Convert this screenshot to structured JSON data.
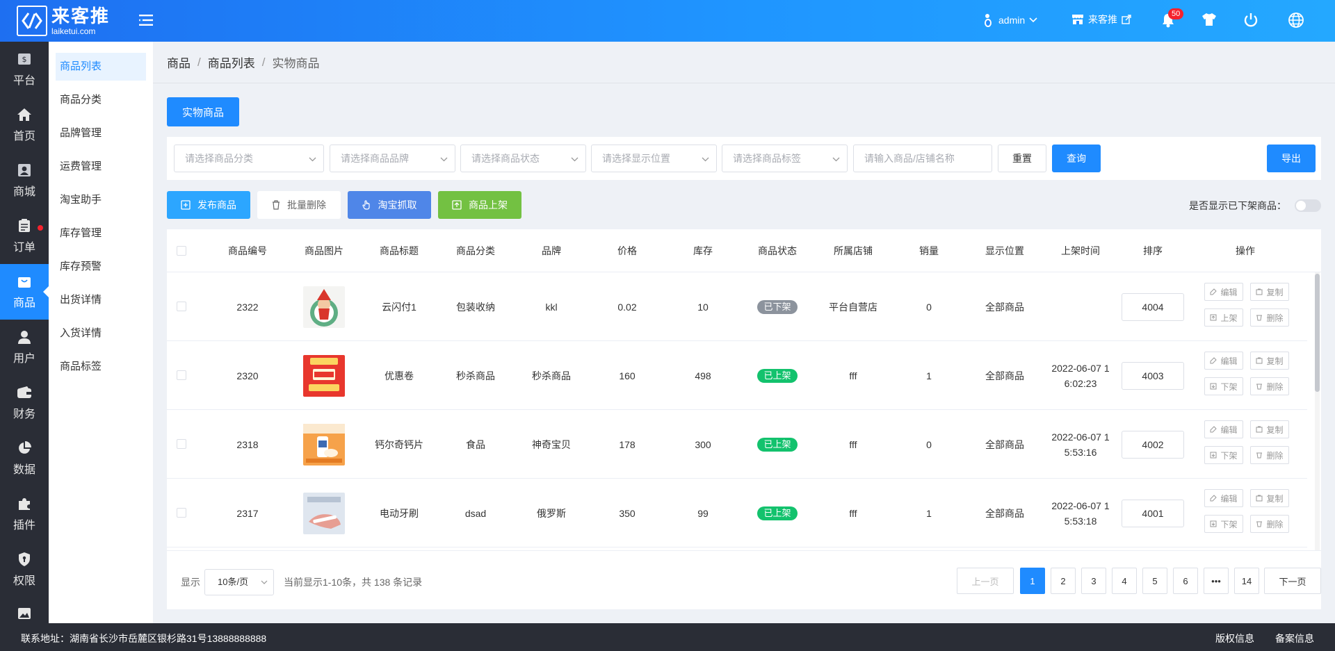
{
  "brand": {
    "name": "来客推",
    "domain": "laiketui.com"
  },
  "topbar": {
    "username": "admin",
    "store_label": "来客推",
    "notifications": "50"
  },
  "colors": {
    "primary": "#1f8bff",
    "success": "#13c26d",
    "taobao": "#4f86e8",
    "shelf": "#73c142",
    "publish": "#2ca6ff"
  },
  "nav_primary": [
    {
      "label": "平台",
      "icon": "dollar-icon"
    },
    {
      "label": "首页",
      "icon": "home-icon"
    },
    {
      "label": "商城",
      "icon": "shop-icon"
    },
    {
      "label": "订单",
      "icon": "clipboard-icon"
    },
    {
      "label": "商品",
      "icon": "bag-icon",
      "active": true
    },
    {
      "label": "用户",
      "icon": "user-icon"
    },
    {
      "label": "财务",
      "icon": "wallet-icon"
    },
    {
      "label": "数据",
      "icon": "pie-icon"
    },
    {
      "label": "插件",
      "icon": "puzzle-icon"
    },
    {
      "label": "权限",
      "icon": "shield-icon"
    }
  ],
  "nav_secondary": [
    "商品列表",
    "商品分类",
    "品牌管理",
    "运费管理",
    "淘宝助手",
    "库存管理",
    "库存预警",
    "出货详情",
    "入货详情",
    "商品标签"
  ],
  "breadcrumb": [
    "商品",
    "商品列表",
    "实物商品"
  ],
  "tab": "实物商品",
  "filters": {
    "category": "请选择商品分类",
    "brand": "请选择商品品牌",
    "status": "请选择商品状态",
    "position": "请选择显示位置",
    "tag": "请选择商品标签",
    "keyword_placeholder": "请输入商品/店铺名称",
    "reset": "重置",
    "query": "查询",
    "export": "导出"
  },
  "actions": {
    "publish": "发布商品",
    "batch_delete": "批量删除",
    "taobao": "淘宝抓取",
    "shelve": "商品上架",
    "toggle_label": "是否显示已下架商品："
  },
  "table": {
    "headers": [
      "商品编号",
      "商品图片",
      "商品标题",
      "商品分类",
      "品牌",
      "价格",
      "库存",
      "商品状态",
      "所属店铺",
      "销量",
      "显示位置",
      "上架时间",
      "排序",
      "操作"
    ],
    "ops": {
      "edit": "编辑",
      "copy": "复制",
      "up": "上架",
      "down": "下架",
      "delete": "删除"
    },
    "rows": [
      {
        "id": "2322",
        "title": "云闪付1",
        "category": "包装收纳",
        "brand": "kkl",
        "price": "0.02",
        "stock": "10",
        "status": "已下架",
        "status_type": "off",
        "store": "平台自营店",
        "sales": "0",
        "position": "全部商品",
        "time1": "",
        "time2": "",
        "sort": "4004",
        "thumb": "elf"
      },
      {
        "id": "2320",
        "title": "优惠卷",
        "category": "秒杀商品",
        "brand": "秒杀商品",
        "price": "160",
        "stock": "498",
        "status": "已上架",
        "status_type": "on",
        "store": "fff",
        "sales": "1",
        "position": "全部商品",
        "time1": "2022-06-07 1",
        "time2": "6:02:23",
        "sort": "4003",
        "thumb": "coupon"
      },
      {
        "id": "2318",
        "title": "钙尔奇钙片",
        "category": "食品",
        "brand": "神奇宝贝",
        "price": "178",
        "stock": "300",
        "status": "已上架",
        "status_type": "on",
        "store": "fff",
        "sales": "0",
        "position": "全部商品",
        "time1": "2022-06-07 1",
        "time2": "5:53:16",
        "sort": "4002",
        "thumb": "bottle"
      },
      {
        "id": "2317",
        "title": "电动牙刷",
        "category": "dsad",
        "brand": "俄罗斯",
        "price": "350",
        "stock": "99",
        "status": "已上架",
        "status_type": "on",
        "store": "fff",
        "sales": "1",
        "position": "全部商品",
        "time1": "2022-06-07 1",
        "time2": "5:53:18",
        "sort": "4001",
        "thumb": "brush"
      }
    ]
  },
  "pagination": {
    "show_label": "显示",
    "page_size": "10条/页",
    "summary": "当前显示1-10条，共 138 条记录",
    "prev": "上一页",
    "next": "下一页",
    "pages": [
      "1",
      "2",
      "3",
      "4",
      "5",
      "6",
      "•••",
      "14"
    ],
    "current": "1"
  },
  "footer": {
    "address": "联系地址：湖南省长沙市岳麓区银杉路31号13888888888",
    "copyright": "版权信息",
    "icp": "备案信息"
  }
}
